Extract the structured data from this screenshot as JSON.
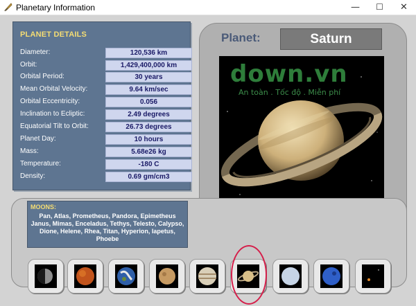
{
  "window": {
    "title": "Planetary Information",
    "controls": {
      "minimize": "—",
      "maximize": "☐",
      "close": "✕"
    }
  },
  "details": {
    "header": "PLANET DETAILS",
    "rows": [
      {
        "label": "Diameter:",
        "value": "120,536 km"
      },
      {
        "label": "Orbit:",
        "value": "1,429,400,000 km"
      },
      {
        "label": "Orbital Period:",
        "value": "30 years"
      },
      {
        "label": "Mean Orbital Velocity:",
        "value": "9.64 km/sec"
      },
      {
        "label": "Orbital  Eccentricity:",
        "value": "0.056"
      },
      {
        "label": "Inclination to Ecliptic:",
        "value": "2.49 degrees"
      },
      {
        "label": "Equatorial Tilt to Orbit:",
        "value": "26.73 degrees"
      },
      {
        "label": "Planet Day:",
        "value": "10 hours"
      },
      {
        "label": "Mass:",
        "value": "5.68e26 kg"
      },
      {
        "label": "Temperature:",
        "value": "-180 C"
      },
      {
        "label": "Density:",
        "value": "0.69 gm/cm3"
      }
    ]
  },
  "planet": {
    "label": "Planet:",
    "name": "Saturn",
    "watermark": "down.vn",
    "watermark_sub": "An toàn . Tốc độ . Miễn phí"
  },
  "moons": {
    "header": "MOONS:",
    "list": "Pan, Atlas, Prometheus, Pandora, Epimetheus Janus, Mimas, Enceladus, Tethys, Telesto, Calypso, Dione, Helene, Rhea, Titan, Hyperion, Iapetus, Phoebe"
  },
  "thumbnails": [
    {
      "planet": "mercury",
      "icon": "mercury-icon"
    },
    {
      "planet": "venus",
      "icon": "venus-icon"
    },
    {
      "planet": "earth",
      "icon": "earth-icon"
    },
    {
      "planet": "mars",
      "icon": "mars-icon"
    },
    {
      "planet": "jupiter",
      "icon": "jupiter-icon"
    },
    {
      "planet": "saturn",
      "icon": "saturn-icon",
      "selected": true
    },
    {
      "planet": "uranus",
      "icon": "uranus-icon"
    },
    {
      "planet": "neptune",
      "icon": "neptune-icon"
    },
    {
      "planet": "pluto",
      "icon": "pluto-icon"
    }
  ],
  "colors": {
    "panel_blue": "#5e7591",
    "header_yellow": "#f5dd73",
    "value_box": "#cfd6ee",
    "selection_ring": "#d51e4a"
  }
}
